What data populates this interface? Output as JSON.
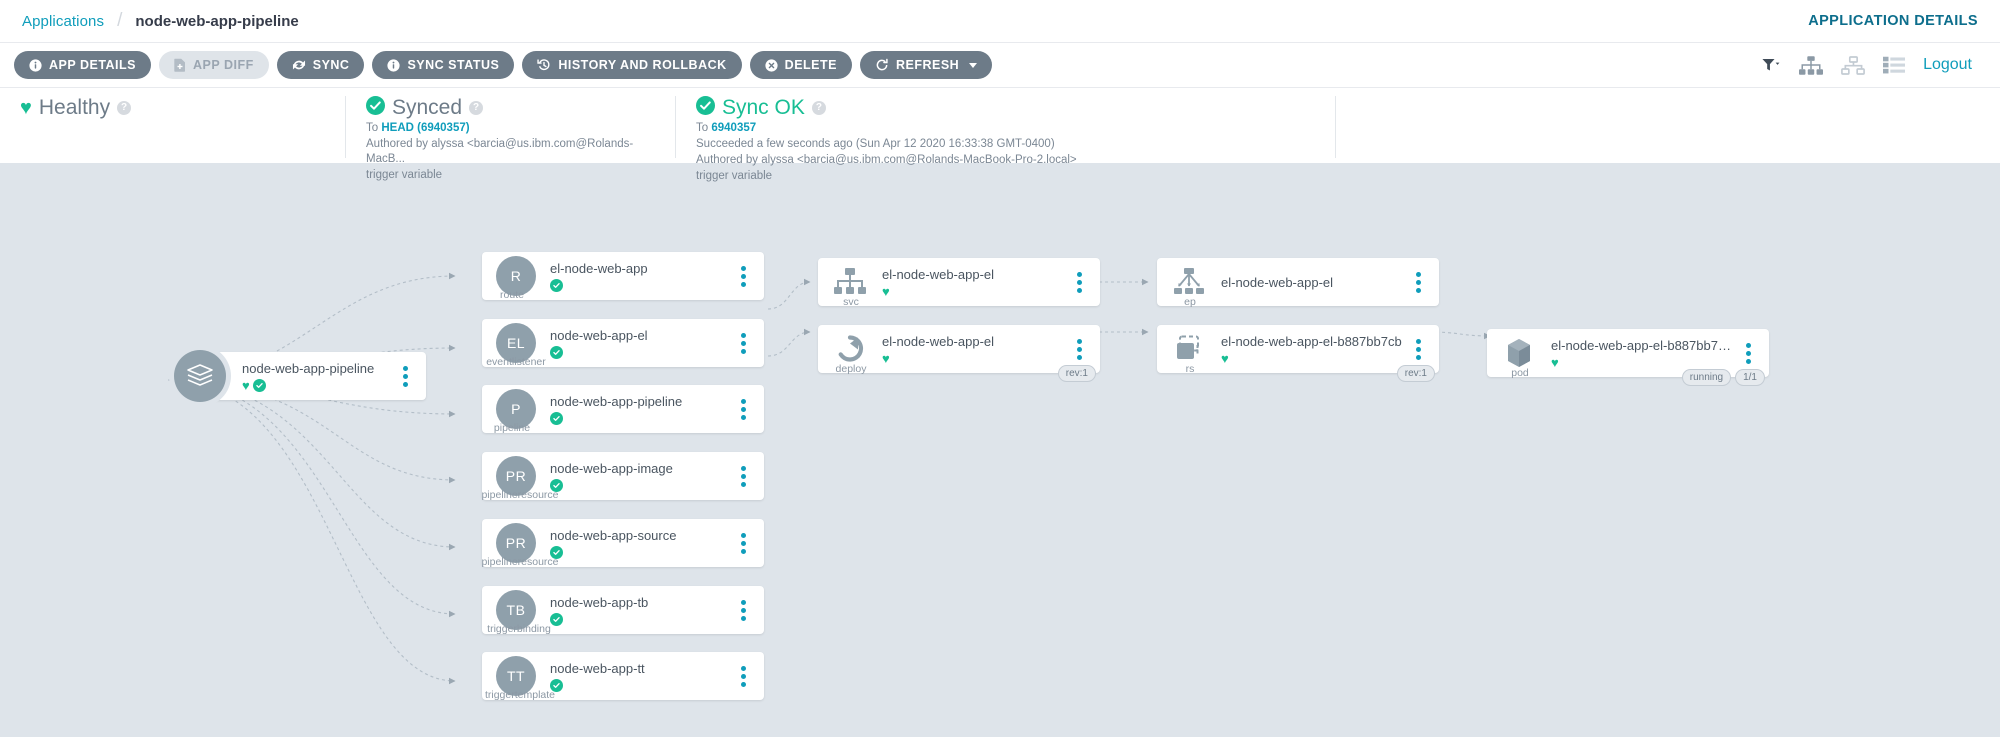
{
  "header": {
    "breadcrumb_root": "Applications",
    "breadcrumb_separator": "/",
    "breadcrumb_current": "node-web-app-pipeline",
    "application_details_label": "APPLICATION DETAILS"
  },
  "toolbar": {
    "buttons": [
      {
        "label": "APP DETAILS",
        "icon": "info-icon",
        "disabled": false
      },
      {
        "label": "APP DIFF",
        "icon": "file-diff-icon",
        "disabled": true
      },
      {
        "label": "SYNC",
        "icon": "sync-icon",
        "disabled": false
      },
      {
        "label": "SYNC STATUS",
        "icon": "info-icon",
        "disabled": false
      },
      {
        "label": "HISTORY AND ROLLBACK",
        "icon": "history-icon",
        "disabled": false
      },
      {
        "label": "DELETE",
        "icon": "delete-icon",
        "disabled": false
      },
      {
        "label": "REFRESH",
        "icon": "refresh-icon",
        "disabled": false,
        "caret": true
      }
    ],
    "right_icons": [
      "filter-icon",
      "tree-view-icon",
      "network-view-icon",
      "list-view-icon"
    ],
    "logout_label": "Logout"
  },
  "status": {
    "health": {
      "title": "Healthy",
      "icon": "heart-icon",
      "help": "?"
    },
    "sync": {
      "title": "Synced",
      "icon": "check-circle-icon",
      "help": "?",
      "to_prefix": "To",
      "revision": "HEAD (6940357)",
      "author": "Authored by alyssa <barcia@us.ibm.com@Rolands-MacB...",
      "message": "trigger variable"
    },
    "operation": {
      "title": "Sync OK",
      "icon": "check-circle-icon",
      "help": "?",
      "to_prefix": "To",
      "revision": "6940357",
      "outcome": "Succeeded a few seconds ago (Sun Apr 12 2020 16:33:38 GMT-0400)",
      "author": "Authored by alyssa <barcia@us.ibm.com@Rolands-MacBook-Pro-2.local>",
      "message": "trigger variable"
    }
  },
  "graph": {
    "app_node": {
      "name": "node-web-app-pipeline",
      "avatar": "app-stack-icon",
      "statuses": [
        "heart-icon",
        "check-circle-icon"
      ]
    },
    "column1": [
      {
        "initials": "R",
        "kind": "route",
        "name": "el-node-web-app",
        "status": "check"
      },
      {
        "initials": "EL",
        "kind": "eventlistener",
        "name": "node-web-app-el",
        "status": "check"
      },
      {
        "initials": "P",
        "kind": "pipeline",
        "name": "node-web-app-pipeline",
        "status": "check"
      },
      {
        "initials": "PR",
        "kind": "pipelineresource",
        "name": "node-web-app-image",
        "status": "check"
      },
      {
        "initials": "PR",
        "kind": "pipelineresource",
        "name": "node-web-app-source",
        "status": "check"
      },
      {
        "initials": "TB",
        "kind": "triggerbinding",
        "name": "node-web-app-tb",
        "status": "check"
      },
      {
        "initials": "TT",
        "kind": "triggertemplate",
        "name": "node-web-app-tt",
        "status": "check"
      }
    ],
    "column2": [
      {
        "icon": "service-icon",
        "kind": "svc",
        "name": "el-node-web-app-el",
        "status": "heart",
        "pills": []
      },
      {
        "icon": "deployment-icon",
        "kind": "deploy",
        "name": "el-node-web-app-el",
        "status": "heart",
        "pills": [
          "rev:1"
        ]
      }
    ],
    "column3": [
      {
        "icon": "endpoint-icon",
        "kind": "ep",
        "name": "el-node-web-app-el",
        "status": "none",
        "pills": []
      },
      {
        "icon": "replicaset-icon",
        "kind": "rs",
        "name": "el-node-web-app-el-b887bb7cb",
        "status": "heart",
        "pills": [
          "rev:1"
        ]
      }
    ],
    "column4": [
      {
        "icon": "pod-icon",
        "kind": "pod",
        "name": "el-node-web-app-el-b887bb7cb...",
        "status": "heart",
        "pills": [
          "running",
          "1/1"
        ]
      }
    ]
  },
  "colors": {
    "accent_teal": "#0f9dbb",
    "healthy_green": "#18be94",
    "toolbar_slate": "#6d7b88",
    "canvas_bg": "#dee4ea",
    "app_details_blue": "#0d6e8c"
  }
}
